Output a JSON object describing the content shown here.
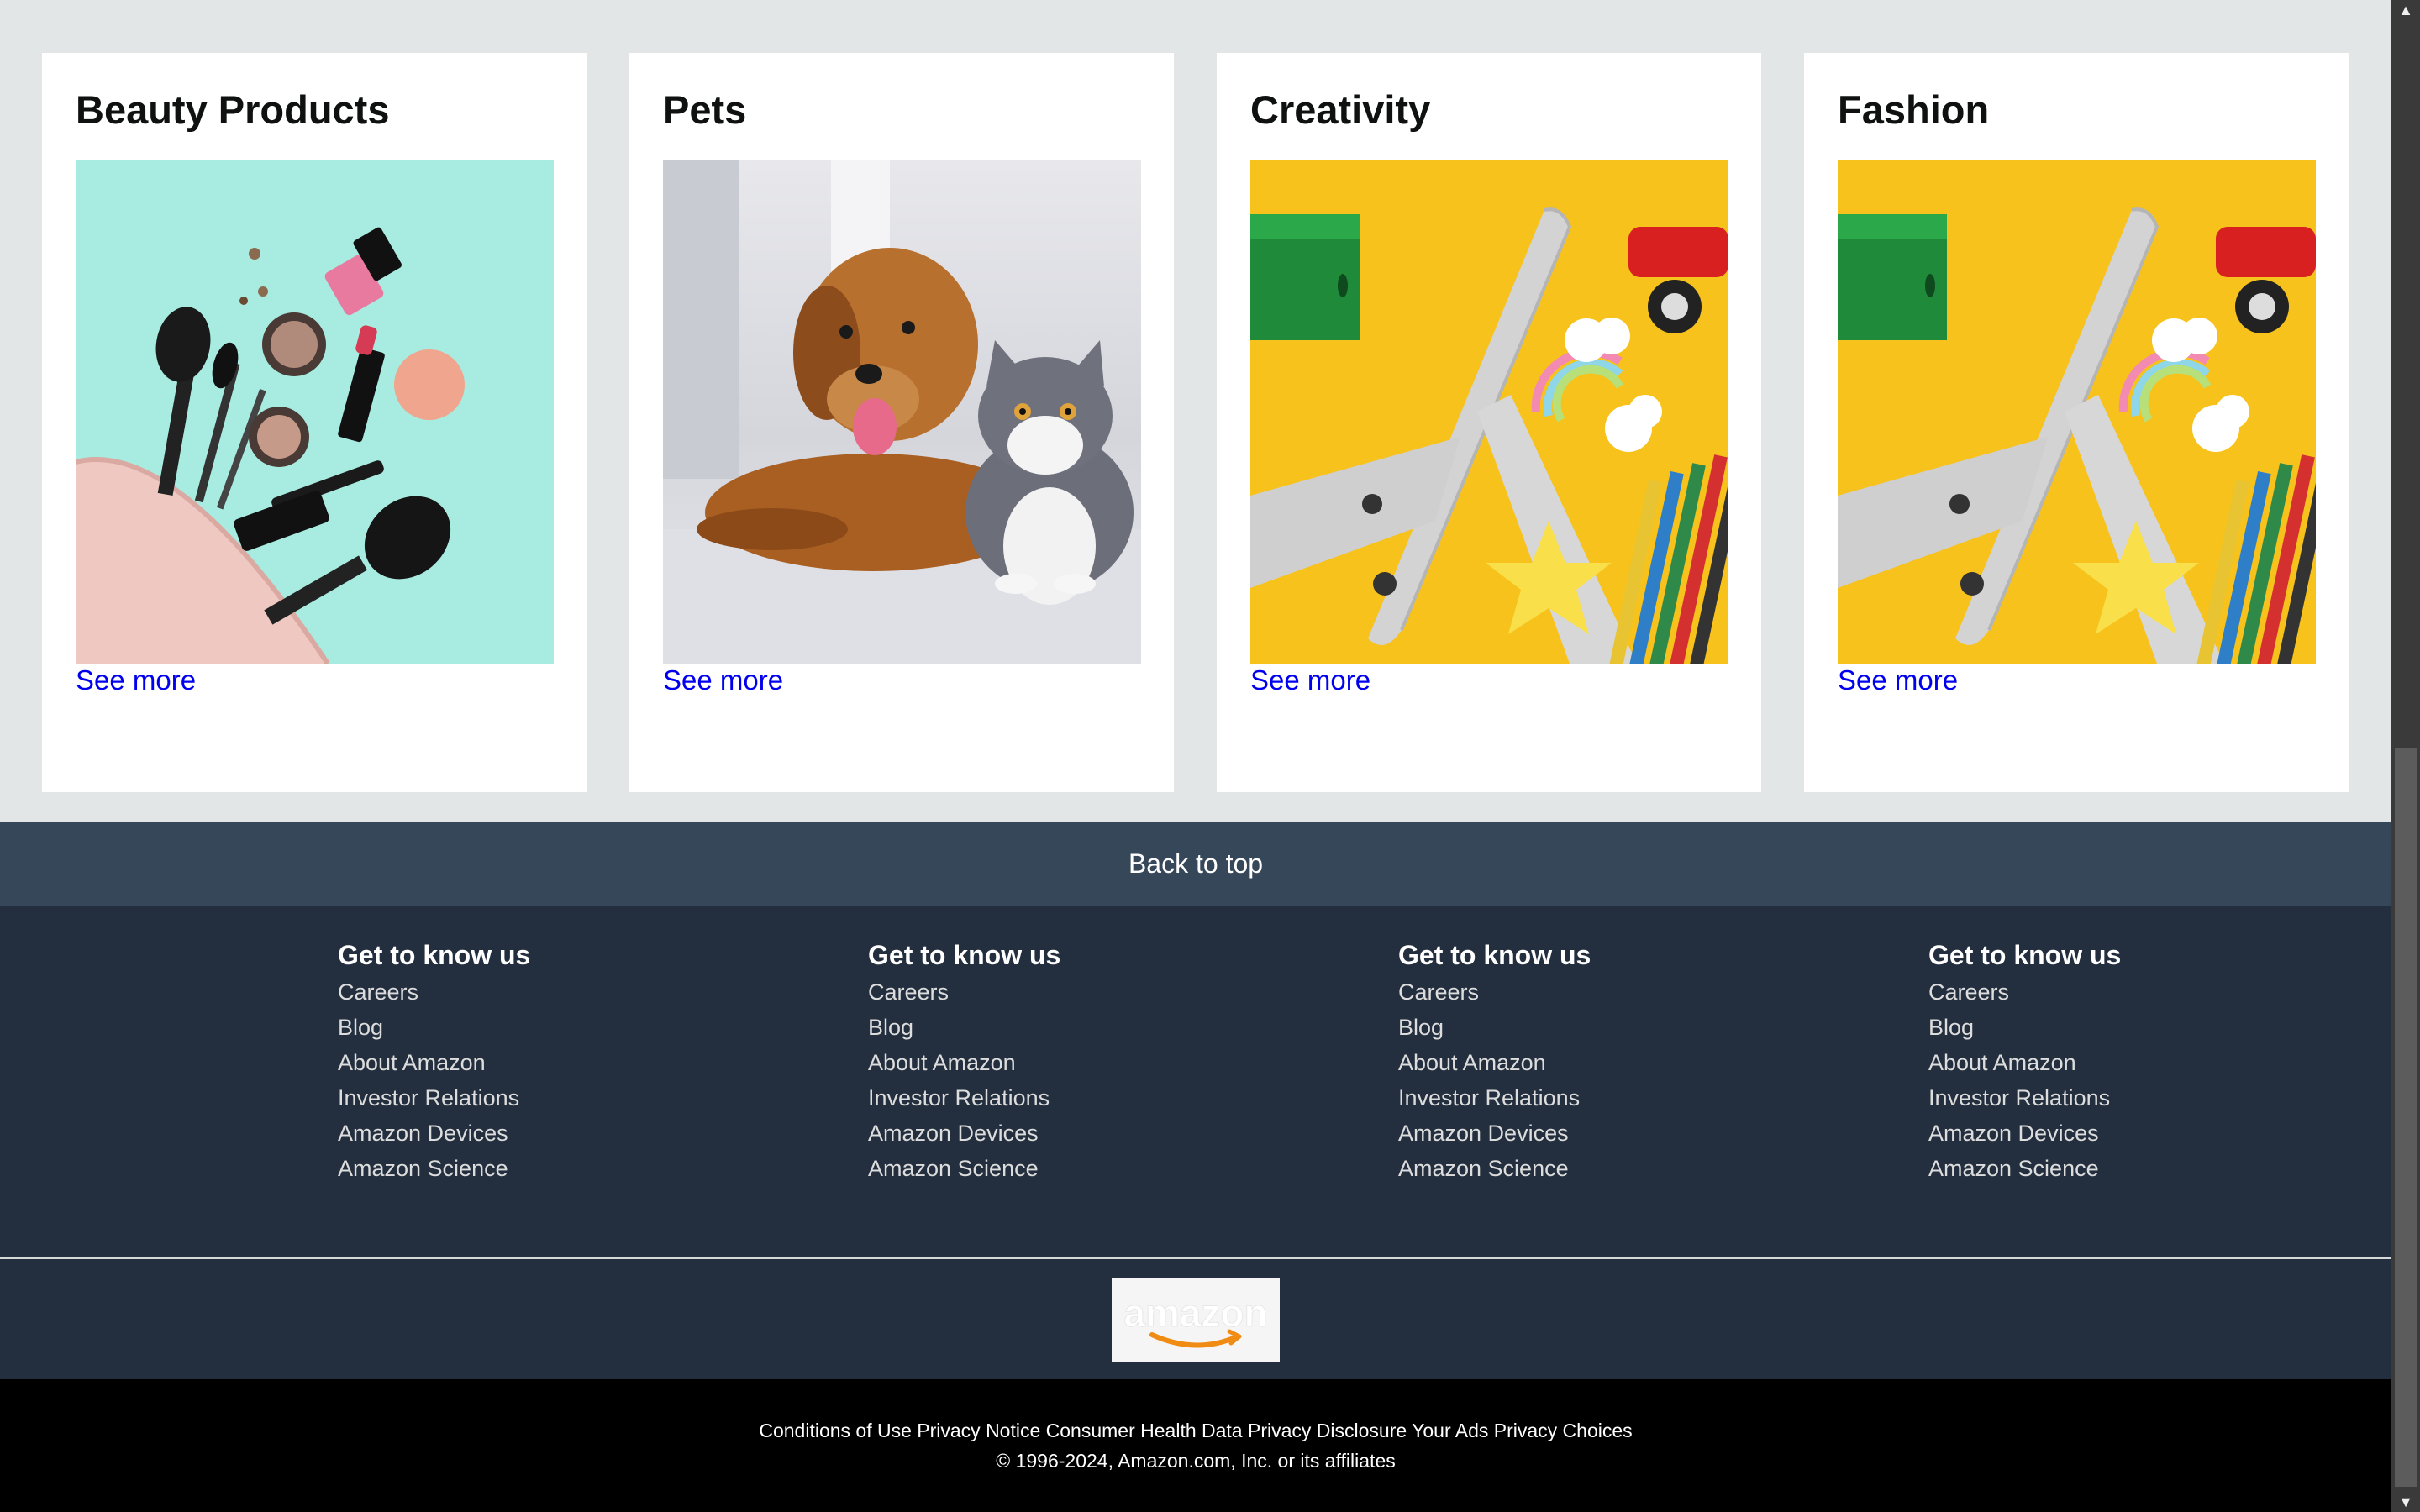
{
  "cards": [
    {
      "title": "Beauty Products",
      "image": "beauty-products-image",
      "link": "See more"
    },
    {
      "title": "Pets",
      "image": "dog-and-cat-image",
      "link": "See more"
    },
    {
      "title": "Creativity",
      "image": "toy-airplane-image",
      "link": "See more"
    },
    {
      "title": "Fashion",
      "image": "toy-airplane-image",
      "link": "See more"
    }
  ],
  "back_to_top": "Back to top",
  "footer": {
    "columns": [
      {
        "heading": "Get to know us",
        "links": [
          "Careers",
          "Blog",
          "About Amazon",
          "Investor Relations",
          "Amazon Devices",
          "Amazon Science"
        ]
      },
      {
        "heading": "Get to know us",
        "links": [
          "Careers",
          "Blog",
          "About Amazon",
          "Investor Relations",
          "Amazon Devices",
          "Amazon Science"
        ]
      },
      {
        "heading": "Get to know us",
        "links": [
          "Careers",
          "Blog",
          "About Amazon",
          "Investor Relations",
          "Amazon Devices",
          "Amazon Science"
        ]
      },
      {
        "heading": "Get to know us",
        "links": [
          "Careers",
          "Blog",
          "About Amazon",
          "Investor Relations",
          "Amazon Devices",
          "Amazon Science"
        ]
      }
    ],
    "logo": "amazon-logo",
    "legal_links": [
      "Conditions of Use",
      "Privacy Notice",
      "Consumer Health Data Privacy Disclosure",
      "Your Ads Privacy Choices"
    ],
    "copyright": "© 1996-2024, Amazon.com, Inc. or its affiliates"
  },
  "colors": {
    "page_background": "#e3e6e6",
    "link": "#0000ee",
    "back_to_top_band": "#37475a",
    "footer_band": "#232f3e",
    "legal_band": "#000000"
  },
  "scrollbar": {
    "scroll_position": 0.97
  }
}
